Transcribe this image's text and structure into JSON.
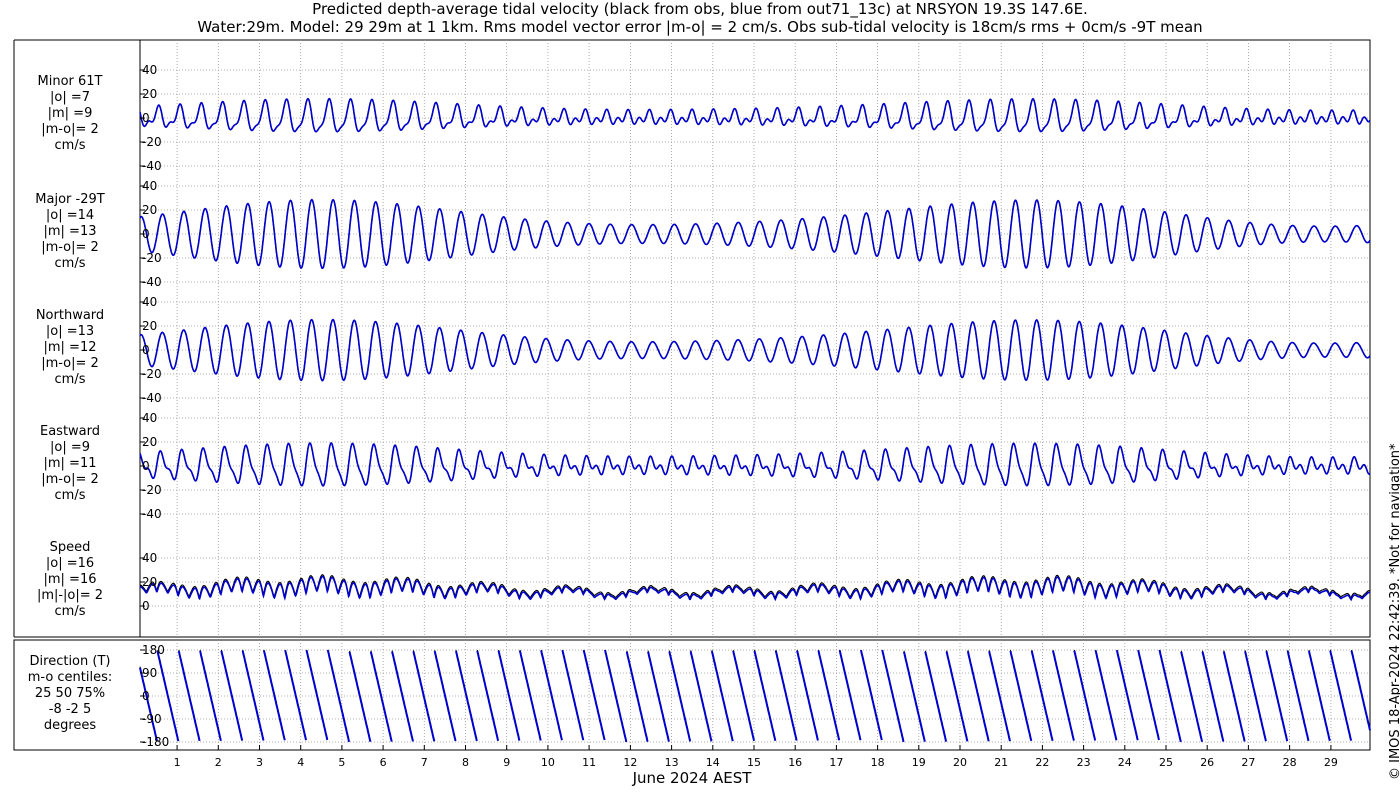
{
  "title_line1": "Predicted depth-average tidal velocity (black from obs, blue from out71_13c) at NRSYON 19.3S 147.6E.",
  "title_line2": "Water:29m. Model: 29 29m at 1 1km. Rms model vector error |m-o| = 2 cm/s. Obs sub-tidal velocity is 18cm/s rms + 0cm/s -9T mean",
  "copyright": "© IMOS 18-Apr-2024 22:42:39. *Not for navigation*",
  "colors": {
    "obs": "#000000",
    "model": "#0000cc",
    "grid": "#999999"
  },
  "chart_data": {
    "type": "line",
    "xlabel": "June 2024 AEST",
    "x_ticks": [
      1,
      2,
      3,
      4,
      5,
      6,
      7,
      8,
      9,
      10,
      11,
      12,
      13,
      14,
      15,
      16,
      17,
      18,
      19,
      20,
      21,
      22,
      23,
      24,
      25,
      26,
      27,
      28,
      29
    ],
    "x_range": [
      0.1,
      29.95
    ],
    "series_names": [
      "obs",
      "model"
    ],
    "panels": [
      {
        "id": "minor",
        "label_lines": [
          "Minor 61T",
          "|o| =7",
          "|m| =9",
          "|m-o|= 2",
          "cm/s"
        ],
        "ylim": [
          -40,
          40
        ],
        "yticks": [
          -40,
          -20,
          0,
          20,
          40
        ]
      },
      {
        "id": "major",
        "label_lines": [
          "Major -29T",
          "|o| =14",
          "|m| =13",
          "|m-o|= 2",
          "cm/s"
        ],
        "ylim": [
          -40,
          40
        ],
        "yticks": [
          -40,
          -20,
          0,
          20,
          40
        ]
      },
      {
        "id": "northward",
        "label_lines": [
          "Northward",
          "|o| =13",
          "|m| =12",
          "|m-o|= 2",
          "cm/s"
        ],
        "ylim": [
          -40,
          40
        ],
        "yticks": [
          -40,
          -20,
          0,
          20,
          40
        ]
      },
      {
        "id": "eastward",
        "label_lines": [
          "Eastward",
          "|o| =9",
          "|m| =11",
          "|m-o|= 2",
          "cm/s"
        ],
        "ylim": [
          -40,
          40
        ],
        "yticks": [
          -40,
          -20,
          0,
          20,
          40
        ]
      },
      {
        "id": "speed",
        "label_lines": [
          "Speed",
          "|o| =16",
          "|m| =16",
          "|m|-|o|= 2",
          "cm/s"
        ],
        "ylim": [
          0,
          40
        ],
        "yticks": [
          0,
          20,
          40
        ]
      },
      {
        "id": "direction",
        "label_lines": [
          "Direction (T)",
          "m-o centiles:",
          "25  50  75%",
          "-8 -2  5",
          "degrees"
        ],
        "ylim": [
          -180,
          180
        ],
        "yticks": [
          -180,
          -90,
          0,
          90,
          180
        ]
      }
    ]
  }
}
